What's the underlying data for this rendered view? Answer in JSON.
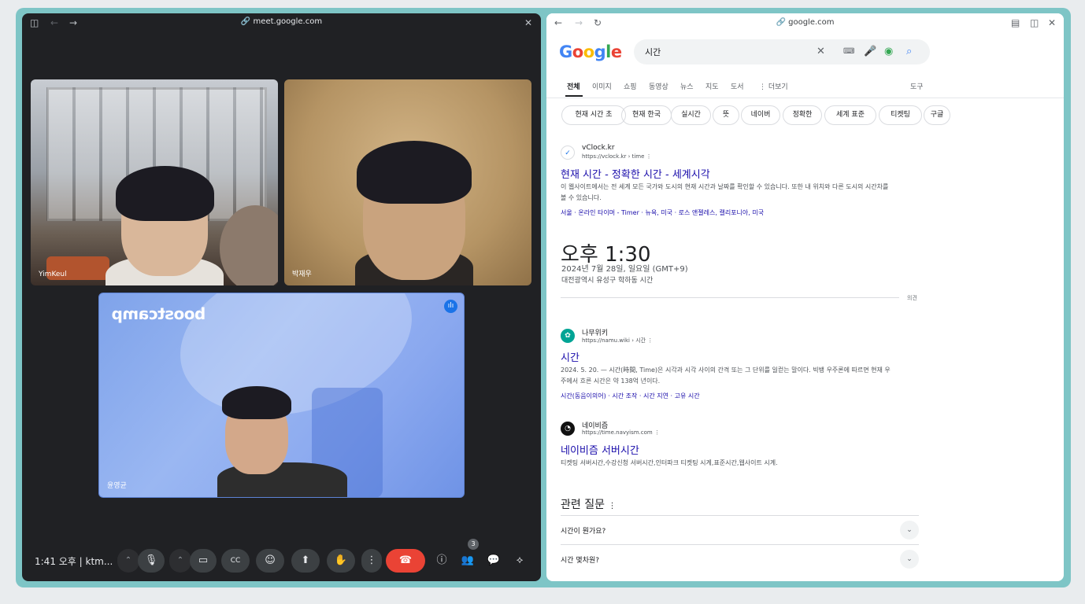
{
  "meet": {
    "url": "meet.google.com",
    "participants": [
      {
        "name": "YimKeul"
      },
      {
        "name": "박재우"
      },
      {
        "name": "윤영균",
        "background_text": "boostcamp"
      }
    ],
    "clock": "1:41 오후 | ktm...",
    "people_count": "3",
    "icons": [
      "sidebar-icon",
      "back-icon",
      "forward-icon",
      "close-icon",
      "chevron-up-icon",
      "mic-icon",
      "camera-icon",
      "captions-icon",
      "emoji-icon",
      "present-icon",
      "raise-hand-icon",
      "more-icon",
      "end-call-icon",
      "info-icon",
      "people-icon",
      "chat-icon",
      "activities-icon"
    ]
  },
  "google": {
    "url": "google.com",
    "logo": "Google",
    "query": "시간",
    "tabs": [
      "전체",
      "이미지",
      "쇼핑",
      "동영상",
      "뉴스",
      "지도",
      "도서",
      "⋮ 더보기",
      "도구"
    ],
    "chips": [
      "현재 시간 초",
      "현재 한국",
      "실시간",
      "뜻",
      "네이버",
      "정확한",
      "세계 표준",
      "티켓팅",
      "구글"
    ],
    "results": [
      {
        "site": "vClock.kr",
        "url": "https://vclock.kr › time",
        "title": "현재 시간 - 정확한 시간 - 세계시각",
        "snippet": "이 웹사이트에서는 전 세계 모든 국가와 도시의 현재 시간과 날짜를 확인할 수 있습니다. 또한 내 위치와 다른 도시의 시간차를 볼 수 있습니다.",
        "links": "서울 · 온라인 타이머 - Timer · 뉴욕, 미국 · 로스 앤젤레스, 캘리포니아, 미국"
      },
      {
        "site": "나무위키",
        "url": "https://namu.wiki › 시간",
        "title": "시간",
        "snippet": "2024. 5. 20. — 시간(時間, Time)은 시각과 시각 사이의 간격 또는 그 단위를 일컫는 말이다. 빅뱅 우주론에 따르면 현재 우주에서 흐른 시간은 약 138억 년이다.",
        "links": "시간(동음이의어) · 시간 조작 · 시간 지연 · 고유 시간"
      },
      {
        "site": "네이비즘",
        "url": "https://time.navyism.com",
        "title": "네이비즘 서버시간",
        "snippet": "티켓팅 서버시간,수강신청 서버시간,인터파크 티켓팅 시계,표준시간,웹사이트 시계."
      }
    ],
    "time_card": {
      "time": "오후 1:30",
      "date": "2024년 7월 28일, 일요일 (GMT+9)",
      "location": "대전광역시 유성구 학하동 시간",
      "feedback": "의견"
    },
    "paa": {
      "title": "관련 질문",
      "questions": [
        "시간이 뭔가요?",
        "시간 몇차원?"
      ]
    }
  }
}
